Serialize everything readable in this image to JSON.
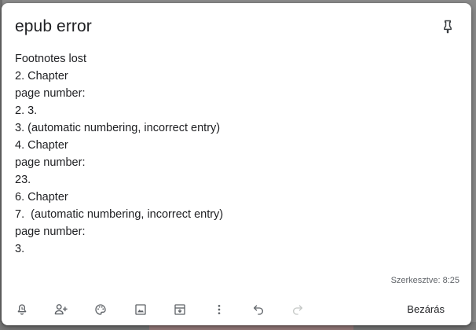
{
  "note": {
    "title": "epub error",
    "lines": [
      "Footnotes lost",
      "2. Chapter",
      "page number:",
      "2. 3.",
      "3. (automatic numbering, incorrect entry)",
      "4. Chapter",
      "page number:",
      "23.",
      "6. Chapter",
      "7.  (automatic numbering, incorrect entry)",
      "page number:",
      "3."
    ],
    "edited": "Szerkesztve: 8:25"
  },
  "toolbar": {
    "icons": [
      "reminder-bell-icon",
      "collaborator-icon",
      "palette-icon",
      "image-icon",
      "archive-icon",
      "more-vert-icon",
      "undo-icon",
      "redo-icon"
    ],
    "close_label": "Bezárás"
  },
  "colors": {
    "text": "#202124",
    "icon": "#5f6368",
    "disabled_icon": "#c4c7c5",
    "card": "#ffffff"
  }
}
